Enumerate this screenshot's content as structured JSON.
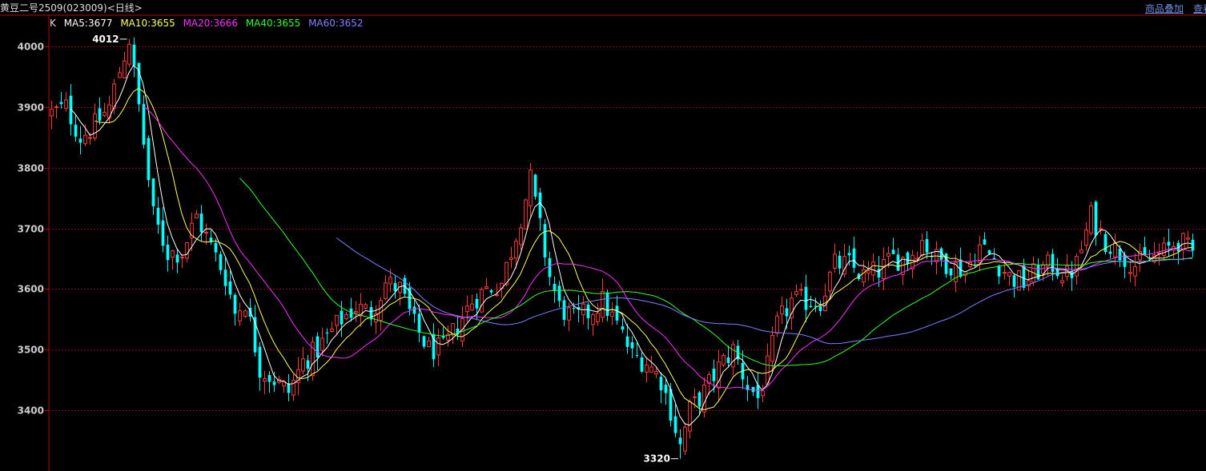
{
  "header": {
    "title": "黄豆二号2509(023009)<日线>",
    "link_overlay": "商品叠加",
    "link_query": "查看"
  },
  "legend": {
    "k": "K",
    "ma5": "MA5:3677",
    "ma10": "MA10:3655",
    "ma20": "MA20:3666",
    "ma40": "MA40:3655",
    "ma60": "MA60:3652"
  },
  "colors": {
    "up": "#ff3b3b",
    "down": "#00ffff",
    "ma5": "#ffffff",
    "ma10": "#ffff60",
    "ma20": "#ff30ff",
    "ma40": "#30ff30",
    "ma60": "#8080ff",
    "grid": "#8b0000",
    "axis": "#c00000"
  },
  "chart_data": {
    "type": "candlestick",
    "ylim": [
      3300,
      4060
    ],
    "yticks": [
      3400,
      3500,
      3600,
      3700,
      3800,
      3900,
      4000
    ],
    "high_label": "4012",
    "low_label": "3320",
    "high_value": 4012,
    "low_value": 3320,
    "keypoints": [
      [
        0,
        3890
      ],
      [
        3,
        3900
      ],
      [
        6,
        3850
      ],
      [
        9,
        3870
      ],
      [
        12,
        3900
      ],
      [
        14,
        3960
      ],
      [
        16,
        4012
      ],
      [
        18,
        3900
      ],
      [
        21,
        3720
      ],
      [
        24,
        3660
      ],
      [
        27,
        3660
      ],
      [
        30,
        3720
      ],
      [
        33,
        3670
      ],
      [
        36,
        3620
      ],
      [
        38,
        3560
      ],
      [
        40,
        3580
      ],
      [
        43,
        3470
      ],
      [
        46,
        3450
      ],
      [
        49,
        3430
      ],
      [
        52,
        3480
      ],
      [
        55,
        3500
      ],
      [
        57,
        3520
      ],
      [
        60,
        3550
      ],
      [
        63,
        3570
      ],
      [
        66,
        3560
      ],
      [
        69,
        3610
      ],
      [
        72,
        3600
      ],
      [
        75,
        3540
      ],
      [
        78,
        3500
      ],
      [
        81,
        3500
      ],
      [
        84,
        3540
      ],
      [
        87,
        3580
      ],
      [
        90,
        3600
      ],
      [
        93,
        3610
      ],
      [
        96,
        3690
      ],
      [
        99,
        3780
      ],
      [
        101,
        3700
      ],
      [
        103,
        3620
      ],
      [
        105,
        3570
      ],
      [
        108,
        3550
      ],
      [
        111,
        3560
      ],
      [
        114,
        3580
      ],
      [
        117,
        3540
      ],
      [
        120,
        3490
      ],
      [
        123,
        3480
      ],
      [
        126,
        3450
      ],
      [
        128,
        3400
      ],
      [
        130,
        3340
      ],
      [
        132,
        3400
      ],
      [
        135,
        3430
      ],
      [
        138,
        3470
      ],
      [
        141,
        3500
      ],
      [
        144,
        3440
      ],
      [
        146,
        3420
      ],
      [
        148,
        3470
      ],
      [
        150,
        3540
      ],
      [
        153,
        3580
      ],
      [
        156,
        3580
      ],
      [
        159,
        3580
      ],
      [
        162,
        3640
      ],
      [
        165,
        3640
      ],
      [
        168,
        3620
      ],
      [
        171,
        3630
      ],
      [
        174,
        3650
      ],
      [
        177,
        3650
      ],
      [
        180,
        3680
      ],
      [
        183,
        3650
      ],
      [
        186,
        3640
      ],
      [
        189,
        3630
      ],
      [
        192,
        3670
      ],
      [
        195,
        3650
      ],
      [
        198,
        3620
      ],
      [
        201,
        3610
      ],
      [
        204,
        3630
      ],
      [
        207,
        3640
      ],
      [
        210,
        3620
      ],
      [
        212,
        3640
      ],
      [
        215,
        3720
      ],
      [
        218,
        3680
      ],
      [
        221,
        3660
      ],
      [
        224,
        3640
      ],
      [
        227,
        3650
      ],
      [
        230,
        3660
      ],
      [
        233,
        3680
      ],
      [
        236,
        3660
      ]
    ],
    "n_candles": 237,
    "series": [
      {
        "name": "MA5",
        "period": 5
      },
      {
        "name": "MA10",
        "period": 10
      },
      {
        "name": "MA20",
        "period": 20
      },
      {
        "name": "MA40",
        "period": 40
      },
      {
        "name": "MA60",
        "period": 60
      }
    ]
  }
}
